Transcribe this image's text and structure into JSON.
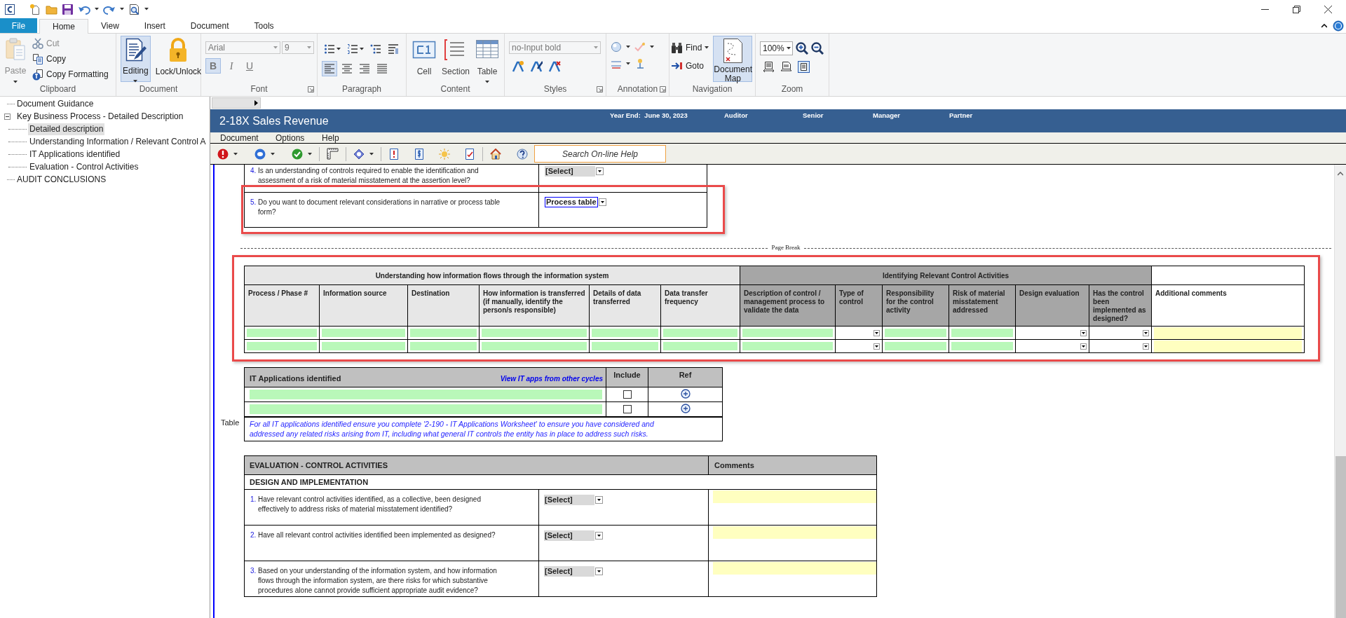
{
  "ribbon": {
    "tabs": [
      {
        "label": "File",
        "kind": "file",
        "selected": false
      },
      {
        "label": "Home",
        "kind": "tab",
        "selected": true
      },
      {
        "label": "View",
        "kind": "tab",
        "selected": false
      },
      {
        "label": "Insert",
        "kind": "tab",
        "selected": false
      },
      {
        "label": "Document",
        "kind": "tab",
        "selected": false
      },
      {
        "label": "Tools",
        "kind": "tab",
        "selected": false
      }
    ],
    "groups": [
      {
        "label": "Clipboard",
        "kind": "clipboard",
        "launcher": false,
        "buttons": [
          {
            "label": "Paste",
            "disabled": true
          },
          {
            "label": "Cut",
            "disabled": true
          },
          {
            "label": "Copy",
            "disabled": false
          },
          {
            "label": "Copy Formatting",
            "disabled": false
          }
        ]
      },
      {
        "label": "Document",
        "kind": "document",
        "launcher": false,
        "buttons": [
          {
            "label": "Editing",
            "selected": true
          },
          {
            "label": "Lock/Unlock",
            "selected": false
          }
        ]
      },
      {
        "label": "Font",
        "kind": "font",
        "launcher": true,
        "font_name": "Arial",
        "font_size": "9",
        "buttons": [
          {
            "label": "B",
            "selected": true
          },
          {
            "label": "I",
            "selected": false
          },
          {
            "label": "U",
            "selected": false
          }
        ]
      },
      {
        "label": "Paragraph",
        "kind": "paragraph",
        "launcher": false,
        "alignments": [
          {
            "selected": true
          },
          {
            "selected": false
          },
          {
            "selected": false
          },
          {
            "selected": false
          }
        ]
      },
      {
        "label": "Content",
        "kind": "content",
        "launcher": false,
        "buttons": [
          {
            "label": "Cell"
          },
          {
            "label": "Section"
          },
          {
            "label": "Table"
          }
        ]
      },
      {
        "label": "Styles",
        "kind": "styles",
        "launcher": true,
        "style_name": "no-Input bold"
      },
      {
        "label": "Annotation",
        "kind": "annotation",
        "launcher": true
      },
      {
        "label": "Navigation",
        "kind": "navigation",
        "launcher": false,
        "buttons": [
          {
            "label": "Find",
            "selected": false
          },
          {
            "label": "Goto",
            "selected": false
          },
          {
            "label": "Document Map",
            "selected": true
          }
        ]
      },
      {
        "label": "Zoom",
        "kind": "zoom",
        "launcher": false,
        "zoom_level": "100%"
      }
    ]
  },
  "tree": [
    {
      "label": "Document Guidance",
      "selected": false
    },
    {
      "label": "Key Business Process - Detailed Description",
      "selected": false,
      "expanded": true,
      "children": [
        {
          "label": "Detailed description",
          "selected": true
        },
        {
          "label": "Understanding Information / Relevant Control A",
          "selected": false
        },
        {
          "label": "IT Applications identified",
          "selected": false
        },
        {
          "label": "Evaluation - Control Activities",
          "selected": false
        }
      ]
    },
    {
      "label": "AUDIT CONCLUSIONS",
      "selected": false
    }
  ],
  "document": {
    "title": "2-18X Sales Revenue",
    "header_fields": [
      "Year End:  June 30, 2023",
      "Auditor",
      "Senior",
      "Manager",
      "Partner"
    ],
    "menu": [
      "Document",
      "Options",
      "Help"
    ],
    "search_placeholder": "Search On-line Help",
    "questions": [
      {
        "number": "4.",
        "text": "Is an understanding of controls required to enable the identification and assessment of a risk of material misstatement at the assertion level?",
        "value": "[Select]",
        "focused": false
      },
      {
        "number": "5.",
        "text": "Do you want to document relevant considerations in narrative or process table form?",
        "value": "Process table",
        "focused": true
      }
    ],
    "page_break": "Page Break",
    "process_table": {
      "bands": [
        {
          "kind": "flow",
          "label": "Understanding how information flows through the information system",
          "columns": [
            "Process / Phase #",
            "Information source",
            "Destination",
            "How information is transferred (if manually, identify the person/s responsible)",
            "Details of data transferred",
            "Data transfer frequency"
          ]
        },
        {
          "kind": "control",
          "label": "Identifying Relevant Control Activities",
          "columns": [
            "Description of control / management process to validate the data",
            "Type of control",
            "Responsibility for the control activity",
            "Risk of material misstatement addressed",
            "Design evaluation",
            "Has the control been implemented as designed?"
          ]
        },
        {
          "kind": "comments",
          "columns": [
            "Additional comments"
          ]
        }
      ],
      "rows": [
        {
          "cells": [
            {
              "kind": "text"
            },
            {
              "kind": "text"
            },
            {
              "kind": "text"
            },
            {
              "kind": "text"
            },
            {
              "kind": "text"
            },
            {
              "kind": "text"
            },
            {
              "kind": "text"
            },
            {
              "kind": "select"
            },
            {
              "kind": "text"
            },
            {
              "kind": "text"
            },
            {
              "kind": "select"
            },
            {
              "kind": "select"
            },
            {
              "kind": "comment"
            }
          ]
        },
        {
          "cells": [
            {
              "kind": "text"
            },
            {
              "kind": "text"
            },
            {
              "kind": "text"
            },
            {
              "kind": "text"
            },
            {
              "kind": "text"
            },
            {
              "kind": "text"
            },
            {
              "kind": "text"
            },
            {
              "kind": "select"
            },
            {
              "kind": "text"
            },
            {
              "kind": "text"
            },
            {
              "kind": "select"
            },
            {
              "kind": "select"
            },
            {
              "kind": "comment"
            }
          ]
        }
      ]
    },
    "side_label": "Table",
    "it_applications": {
      "title": "IT Applications identified",
      "link": "View IT apps from other cycles",
      "columns": [
        "Include",
        "Ref"
      ],
      "rows": [
        {
          "checked": false
        },
        {
          "checked": false
        }
      ],
      "note": "For all IT applications identified ensure you complete '2-190 - IT Applications Worksheet' to ensure you have considered and addressed any related risks arising from IT, including what general IT controls the entity has in place to address such risks."
    },
    "evaluation": {
      "title": "EVALUATION - CONTROL ACTIVITIES",
      "comments_header": "Comments",
      "section": "DESIGN AND IMPLEMENTATION",
      "questions": [
        {
          "number": "1.",
          "text": "Have relevant control activities identified, as a collective, been designed effectively to address risks of material misstatement identified?",
          "value": "[Select]",
          "focused": false
        },
        {
          "number": "2.",
          "text": "Have all relevant control activities identified been implemented as designed?",
          "value": "[Select]",
          "focused": false
        },
        {
          "number": "3.",
          "text": "Based on your understanding of the information system, and how information flows through the information system, are there risks for which substantive procedures alone cannot provide sufficient appropriate audit evidence?",
          "value": "[Select]",
          "focused": false
        }
      ]
    }
  }
}
